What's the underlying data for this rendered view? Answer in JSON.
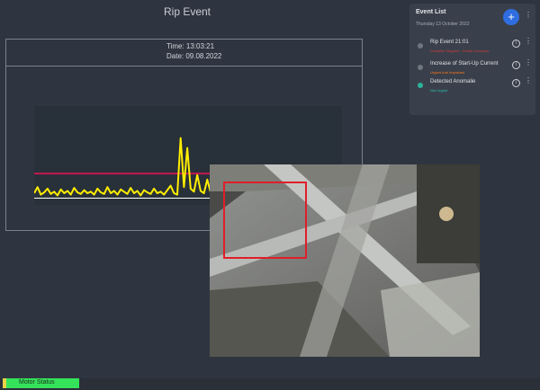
{
  "page": {
    "title": "Rip Event"
  },
  "chart_info": {
    "time_label": "Time: 13:03:21",
    "date_label": "Date: 09.08.2022"
  },
  "chart_data": {
    "type": "line",
    "title": "",
    "xlabel": "",
    "ylabel": "",
    "grid": false,
    "ylim": [
      0,
      100
    ],
    "series": [
      {
        "color": "#ffee00",
        "values": [
          6,
          14,
          4,
          7,
          12,
          5,
          8,
          3,
          11,
          6,
          9,
          4,
          13,
          7,
          5,
          10,
          6,
          8,
          4,
          12,
          7,
          5,
          14,
          6,
          9,
          4,
          11,
          8,
          5,
          13,
          6,
          9,
          3,
          10,
          7,
          5,
          12,
          6,
          8,
          4,
          10,
          16,
          6,
          4,
          79,
          14,
          66,
          12,
          8,
          30,
          9,
          6,
          24,
          7
        ]
      }
    ],
    "threshold": {
      "value": 32,
      "color": "#c4184f"
    },
    "baseline_color": "#ffffff"
  },
  "event_list": {
    "title": "Event List",
    "date": "Thursday 13 October 2022",
    "add_button_label": "+",
    "more_label": "⋮",
    "items": [
      {
        "title": "Rip Event 21:01",
        "subtitle": "Consider Stopped - Check Conveyor",
        "subtitle_color": "#e03a3a",
        "status": "grey",
        "info_label": "i",
        "more_label": "⋮"
      },
      {
        "title": "Increase of Start-Up Current",
        "subtitle": "Urgent And Important",
        "subtitle_color": "#ff7a1a",
        "status": "grey",
        "info_label": "i",
        "more_label": "⋮"
      },
      {
        "title": "Detected Anomalie",
        "subtitle": "Not Urgent",
        "subtitle_color": "#27c2b0",
        "status": "teal",
        "info_label": "i",
        "more_label": "⋮"
      }
    ]
  },
  "status": {
    "label": "Motor Status",
    "color": "#35e35a"
  }
}
